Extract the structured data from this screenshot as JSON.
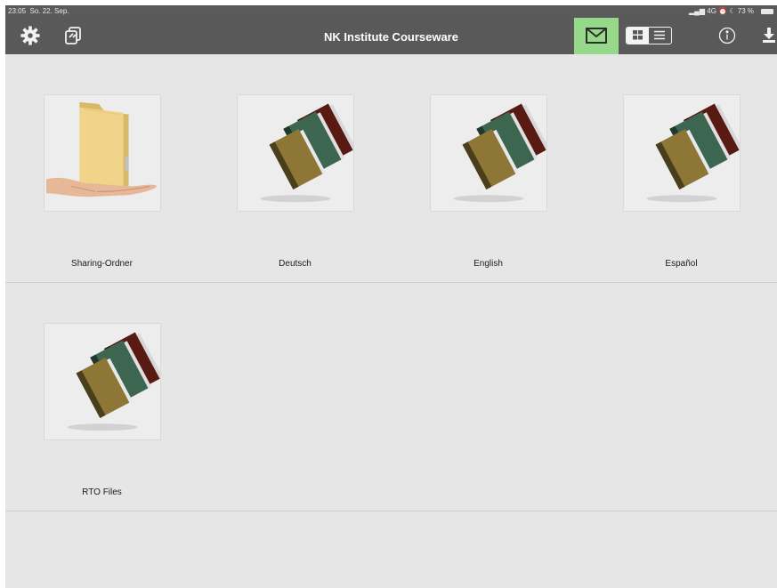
{
  "status": {
    "time": "23:05",
    "date": "So. 22. Sep.",
    "network": "4G",
    "battery": "73 %"
  },
  "nav": {
    "title": "NK Institute Courseware",
    "icons": [
      "gear-icon",
      "copy-icon",
      "mail-icon",
      "grid-view-icon",
      "list-view-icon",
      "info-icon",
      "download-icon"
    ]
  },
  "colors": {
    "bar": "#595959",
    "content_bg": "#e6e6e6",
    "mail_highlight": "#97d98a"
  },
  "folders": [
    {
      "label": "Sharing-Ordner",
      "icon": "shared-folder-icon"
    },
    {
      "label": "Deutsch",
      "icon": "books-icon"
    },
    {
      "label": "English",
      "icon": "books-icon"
    },
    {
      "label": "Español",
      "icon": "books-icon"
    },
    {
      "label": "RTO Files",
      "icon": "books-icon"
    }
  ]
}
